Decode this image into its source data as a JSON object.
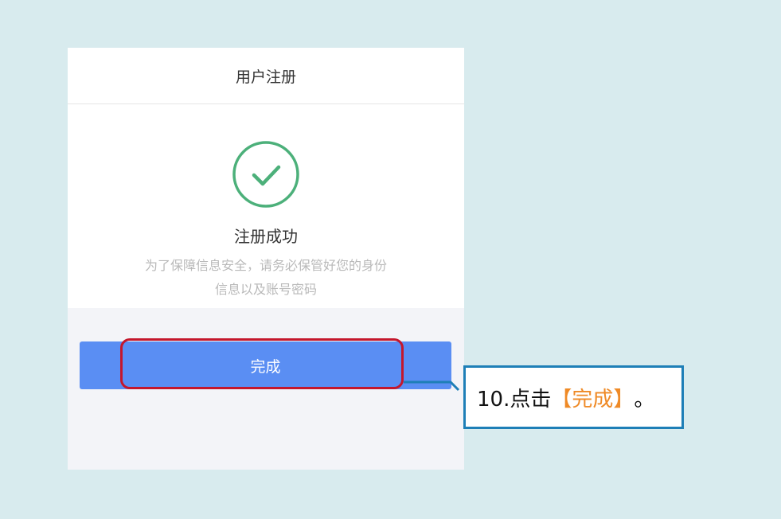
{
  "header": {
    "title": "用户注册"
  },
  "success": {
    "icon": "check-circle-icon",
    "title": "注册成功",
    "tip_line1": "为了保障信息安全，请务必保管好您的身份",
    "tip_line2": "信息以及账号密码"
  },
  "actions": {
    "done_label": "完成"
  },
  "annotation": {
    "prefix": "10.点击",
    "bracket_open": "【",
    "target": "完成",
    "bracket_close": "】",
    "suffix": "。"
  },
  "colors": {
    "background": "#d8ebee",
    "success_green": "#4cb07a",
    "button_blue": "#5a8ef3",
    "highlight_red": "#c4172c",
    "callout_blue": "#1e7fb7",
    "accent_orange": "#ef8a26"
  }
}
